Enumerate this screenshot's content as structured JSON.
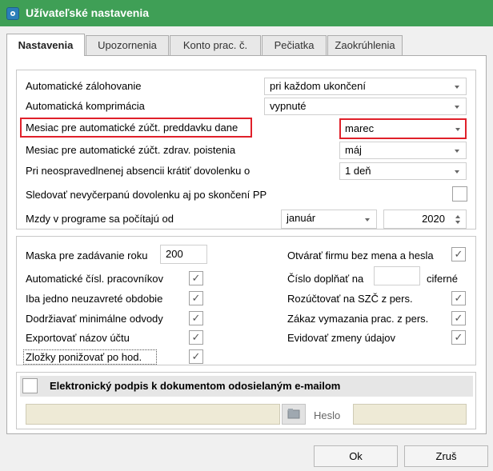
{
  "window": {
    "title": "Užívateľské nastavenia"
  },
  "tabs": [
    {
      "label": "Nastavenia"
    },
    {
      "label": "Upozornenia"
    },
    {
      "label": "Konto prac. č."
    },
    {
      "label": "Pečiatka"
    },
    {
      "label": "Zaokrúhlenia"
    }
  ],
  "settings": {
    "auto_backup": {
      "label": "Automatické zálohovanie",
      "value": "pri každom ukončení"
    },
    "auto_compress": {
      "label": "Automatická komprimácia",
      "value": "vypnuté"
    },
    "tax_month": {
      "label": "Mesiac pre automatické zúčt. preddavku dane",
      "value": "marec"
    },
    "health_month": {
      "label": "Mesiac pre automatické zúčt. zdrav. poistenia",
      "value": "máj"
    },
    "absence": {
      "label": "Pri neospravedlnenej absencii krátiť dovolenku o",
      "value": "1 deň"
    },
    "track_leave": {
      "label": "Sledovať nevyčerpanú dovolenku aj po skončení PP",
      "checked": false
    },
    "wages_from": {
      "label": "Mzdy v programe sa počítajú od",
      "month": "január",
      "year": "2020"
    }
  },
  "options": {
    "year_mask": {
      "label": "Maska pre zadávanie roku",
      "value": "200"
    },
    "auto_numbering": {
      "label": "Automatické čísl. pracovníkov",
      "checked": true
    },
    "one_open_period": {
      "label": "Iba jedno neuzavreté obdobie",
      "checked": true
    },
    "min_contrib": {
      "label": "Dodržiavať minimálne odvody",
      "checked": true
    },
    "export_account": {
      "label": "Exportovať názov účtu",
      "checked": true
    },
    "hourly_items": {
      "label": "Zložky ponižovať po hod.",
      "checked": true
    },
    "open_no_password": {
      "label": "Otvárať firmu bez mena a hesla",
      "checked": true
    },
    "pad_number": {
      "label": "Číslo doplňať na",
      "value": "",
      "suffix": "ciferné"
    },
    "split_szc": {
      "label": "Rozúčtovať na SZČ z pers.",
      "checked": true
    },
    "no_delete": {
      "label": "Zákaz vymazania prac. z pers.",
      "checked": true
    },
    "log_changes": {
      "label": "Evidovať zmeny údajov",
      "checked": true
    }
  },
  "signature": {
    "title": "Elektronický podpis k dokumentom odosielaným e-mailom",
    "enabled": false,
    "certificate": "",
    "password_label": "Heslo",
    "password": ""
  },
  "buttons": {
    "ok": "Ok",
    "cancel": "Zruš"
  },
  "glyphs": {
    "check": "✓"
  },
  "colors": {
    "titlebar": "#3f9f56",
    "highlight": "#e0202a"
  }
}
